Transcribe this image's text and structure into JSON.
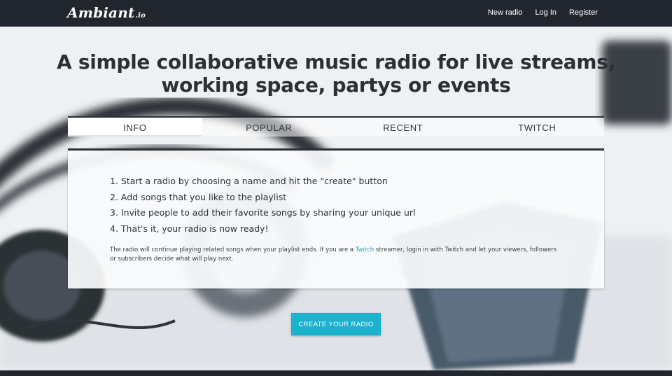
{
  "header": {
    "logo_main": "Ambiant",
    "logo_tld": ".io",
    "nav": [
      {
        "label": "New radio"
      },
      {
        "label": "Log In"
      },
      {
        "label": "Register"
      }
    ]
  },
  "hero": {
    "headline_line1": "A simple collaborative music radio for live streams,",
    "headline_line2": "working space, partys or events"
  },
  "tabs": [
    {
      "label": "INFO",
      "active": true
    },
    {
      "label": "POPULAR",
      "active": false
    },
    {
      "label": "RECENT",
      "active": false
    },
    {
      "label": "TWITCH",
      "active": false
    }
  ],
  "info": {
    "steps": [
      "1. Start a radio by choosing a name and hit the \"create\" button",
      "2. Add songs that you like to the playlist",
      "3. Invite people to add their favorite songs by sharing your unique url",
      "4. That's it, your radio is now ready!"
    ],
    "note_part1": "The radio will continue playing related songs when your playlist ends. If you are a ",
    "note_link": "Twitch",
    "note_part2": " streamer, login in with Twitch and let your viewers, followers or subscribers decide what will play next."
  },
  "cta": {
    "label": "CREATE YOUR RADIO"
  },
  "colors": {
    "topbar": "#22272f",
    "accent": "#1ab2cc",
    "link": "#2aa3b8",
    "text": "#2b2f36"
  }
}
